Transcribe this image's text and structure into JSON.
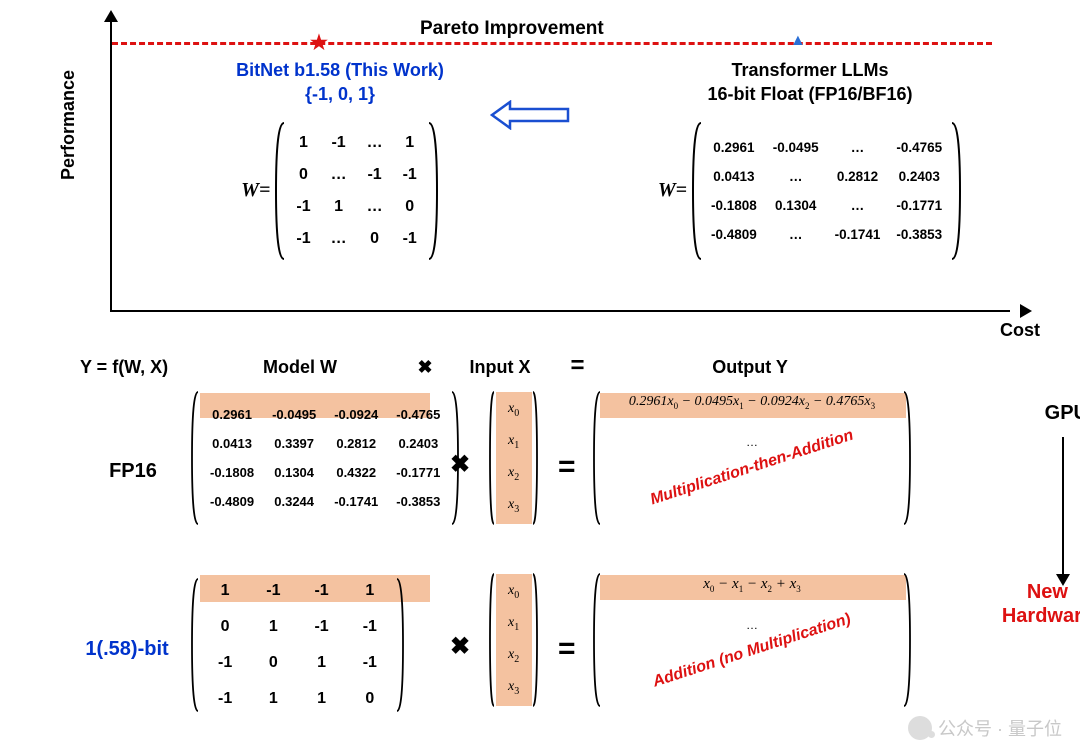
{
  "chart": {
    "pareto_title": "Pareto Improvement",
    "y_label": "Performance",
    "x_label": "Cost"
  },
  "left": {
    "title": "BitNet b1.58 (This Work)",
    "set": "{-1, 0, 1}",
    "W_prefix": "W=",
    "matrix": [
      [
        "1",
        "-1",
        "…",
        "1"
      ],
      [
        "0",
        "…",
        "-1",
        "-1"
      ],
      [
        "-1",
        "1",
        "…",
        "0"
      ],
      [
        "-1",
        "…",
        "0",
        "-1"
      ]
    ]
  },
  "right": {
    "title1": "Transformer LLMs",
    "title2": "16-bit Float (FP16/BF16)",
    "W_prefix": "W=",
    "matrix": [
      [
        "0.2961",
        "-0.0495",
        "…",
        "-0.4765"
      ],
      [
        "0.0413",
        "…",
        "0.2812",
        "0.2403"
      ],
      [
        "-0.1808",
        "0.1304",
        "…",
        "-0.1771"
      ],
      [
        "-0.4809",
        "…",
        "-0.1741",
        "-0.3853"
      ]
    ]
  },
  "hdr": {
    "eq": "Y = f(W, X)",
    "modelW": "Model W",
    "times": "✖",
    "inputX": "Input X",
    "equals": "=",
    "outputY": "Output Y"
  },
  "fp16": {
    "label": "FP16",
    "matrix": [
      [
        "0.2961",
        "-0.0495",
        "-0.0924",
        "-0.4765"
      ],
      [
        "0.0413",
        "0.3397",
        "0.2812",
        "0.2403"
      ],
      [
        "-0.1808",
        "0.1304",
        "0.4322",
        "-0.1771"
      ],
      [
        "-0.4809",
        "0.3244",
        "-0.1741",
        "-0.3853"
      ]
    ],
    "vec": [
      "x₀",
      "x₁",
      "x₂",
      "x₃"
    ],
    "out_formula": "0.2961x₀ − 0.0495x₁ − 0.0924x₂ − 0.4765x₃",
    "dots": "…",
    "red": "Multiplication-then-Addition",
    "gpu": "GPU"
  },
  "bit": {
    "label": "1(.58)-bit",
    "matrix": [
      [
        "1",
        "-1",
        "-1",
        "1"
      ],
      [
        "0",
        "1",
        "-1",
        "-1"
      ],
      [
        "-1",
        "0",
        "1",
        "-1"
      ],
      [
        "-1",
        "1",
        "1",
        "0"
      ]
    ],
    "vec": [
      "x₀",
      "x₁",
      "x₂",
      "x₃"
    ],
    "out_formula": "x₀ − x₁ − x₂ + x₃",
    "dots": "…",
    "red": "Addition (no Multiplication)",
    "newhw1": "New",
    "newhw2": "Hardware"
  },
  "watermark": "公众号 · 量子位",
  "chart_data": {
    "type": "scatter",
    "title": "Pareto Improvement",
    "xlabel": "Cost",
    "ylabel": "Performance",
    "series": [
      {
        "name": "BitNet b1.58 (This Work)",
        "x_rel": 0.23,
        "y_rel": 1.0,
        "marker": "star",
        "color": "#d11"
      },
      {
        "name": "Transformer LLMs 16-bit Float (FP16/BF16)",
        "x_rel": 0.78,
        "y_rel": 1.0,
        "marker": "triangle",
        "color": "#2b6fd6"
      }
    ],
    "note": "Both points lie on the same (dashed) performance level; BitNet sits at lower cost, indicating a Pareto improvement (arrow from right to left)."
  }
}
